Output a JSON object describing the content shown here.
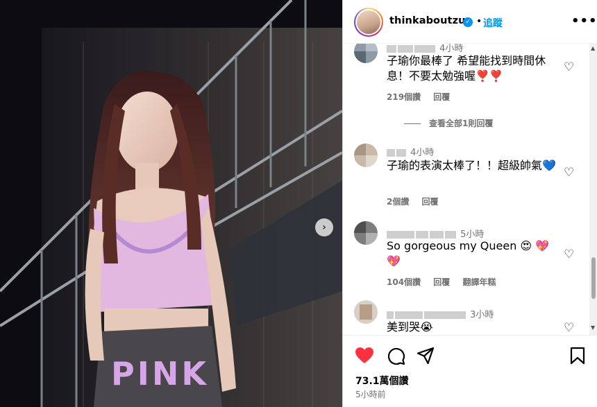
{
  "post": {
    "username": "thinkaboutzu",
    "follow_label": "追蹤",
    "separator": "•",
    "more_label": "•••",
    "next_label": "›",
    "likes": "73.1萬個讚",
    "posted": "5小時前"
  },
  "comments": [
    {
      "time": "4小時",
      "text": "子瑜你最棒了  希望能找到時間休息！不要太勉強喔❣️❣️",
      "likes": "219個讚",
      "reply": "回覆",
      "view_replies": "查看全部1則回覆"
    },
    {
      "time": "4小時",
      "text": "子瑜的表演太棒了！！超級帥氣💙",
      "likes": "2個讚",
      "reply": "回覆"
    },
    {
      "time": "5小時",
      "text": "So gorgeous my Queen 😍 💖💖",
      "likes": "104個讚",
      "reply": "回覆",
      "translate": "翻譯年糕"
    },
    {
      "time": "3小時",
      "text": "美到哭😭"
    }
  ],
  "colors": {
    "accent": "#0095f6",
    "like_red": "#ff3040",
    "muted": "#737373"
  },
  "icons": [
    "verified-icon",
    "heart-icon",
    "comment-icon",
    "share-icon",
    "bookmark-icon",
    "chevron-right-icon",
    "more-icon"
  ]
}
